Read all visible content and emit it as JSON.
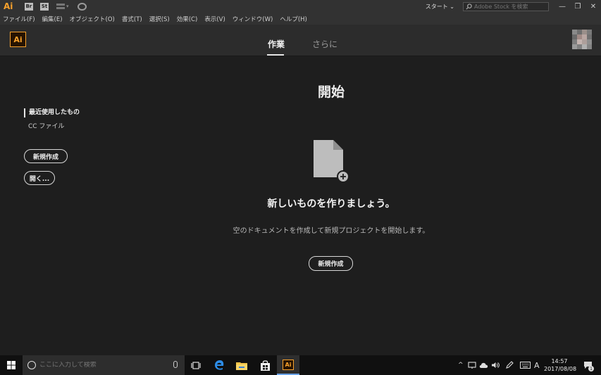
{
  "titlebar": {
    "app_mark": "Ai",
    "bridge_badge": "Br",
    "stock_badge": "St",
    "workspace_label": "スタート",
    "stock_search_placeholder": "Adobe Stock を検索",
    "minimize": "—",
    "restore": "❐",
    "close": "✕"
  },
  "menu": [
    "ファイル(F)",
    "編集(E)",
    "オブジェクト(O)",
    "書式(T)",
    "選択(S)",
    "効果(C)",
    "表示(V)",
    "ウィンドウ(W)",
    "ヘルプ(H)"
  ],
  "header": {
    "logo": "Ai",
    "tabs": [
      {
        "label": "作業",
        "active": true
      },
      {
        "label": "さらに",
        "active": false
      }
    ]
  },
  "sidebar": {
    "recent_label": "最近使用したもの",
    "cc_files_label": "CC ファイル",
    "new_button": "新規作成",
    "open_button": "開く..."
  },
  "main": {
    "title": "開始",
    "headline": "新しいものを作りましょう。",
    "subline": "空のドキュメントを作成して新規プロジェクトを開始します。",
    "new_button": "新規作成"
  },
  "taskbar": {
    "search_placeholder": "ここに入力して検索",
    "ime_label": "A",
    "time": "14:57",
    "date": "2017/08/08",
    "notification_count": "1",
    "ai_label": "Ai"
  },
  "colors": {
    "ai_orange": "#f7a12c",
    "background": "#1e1e1e",
    "header": "#2c2c2c",
    "chrome": "#323232",
    "taskbar": "#101010"
  }
}
